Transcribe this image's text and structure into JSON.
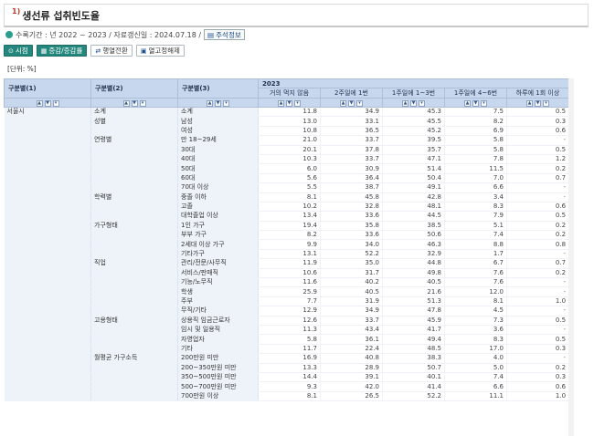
{
  "title": {
    "number": "1)",
    "text": "생선류 섭취빈도율"
  },
  "meta": {
    "text": "수록기간 : 년 2022 ~ 2023 / 자료갱신일 : 2024.07.18 /",
    "note_label": "주석정보"
  },
  "toolbar": {
    "buttons": [
      {
        "label": "시점",
        "icon": "⊙"
      },
      {
        "label": "증감/증감률",
        "icon": "▦"
      },
      {
        "label": "행열전환",
        "icon": "⇄"
      },
      {
        "label": "열고정해제",
        "icon": "▣"
      }
    ]
  },
  "unit": "[단위: %]",
  "table": {
    "group_headers": [
      "구분별(1)",
      "구분별(2)",
      "구분별(3)"
    ],
    "year": "2023",
    "columns": [
      "거의 먹지 않음",
      "2주일에 1번",
      "1주일에 1~3번",
      "1주일에 4~6번",
      "하루에 1회 이상"
    ],
    "rows": [
      {
        "c1": "서울시",
        "c2": "소계",
        "c3": "소계",
        "v": [
          "11.8",
          "34.9",
          "45.3",
          "7.5",
          "0.5"
        ]
      },
      {
        "c1": "",
        "c2": "성별",
        "c3": "남성",
        "v": [
          "13.0",
          "33.1",
          "45.5",
          "8.2",
          "0.3"
        ]
      },
      {
        "c1": "",
        "c2": "",
        "c3": "여성",
        "v": [
          "10.8",
          "36.5",
          "45.2",
          "6.9",
          "0.6"
        ]
      },
      {
        "c1": "",
        "c2": "연령별",
        "c3": "만 18~29세",
        "v": [
          "21.0",
          "33.7",
          "39.5",
          "5.8",
          "-"
        ]
      },
      {
        "c1": "",
        "c2": "",
        "c3": "30대",
        "v": [
          "20.1",
          "37.8",
          "35.7",
          "5.8",
          "0.5"
        ]
      },
      {
        "c1": "",
        "c2": "",
        "c3": "40대",
        "v": [
          "10.3",
          "33.7",
          "47.1",
          "7.8",
          "1.2"
        ]
      },
      {
        "c1": "",
        "c2": "",
        "c3": "50대",
        "v": [
          "6.0",
          "30.9",
          "51.4",
          "11.5",
          "0.2"
        ]
      },
      {
        "c1": "",
        "c2": "",
        "c3": "60대",
        "v": [
          "5.6",
          "36.4",
          "50.4",
          "7.0",
          "0.7"
        ]
      },
      {
        "c1": "",
        "c2": "",
        "c3": "70대 이상",
        "v": [
          "5.5",
          "38.7",
          "49.1",
          "6.6",
          "-"
        ]
      },
      {
        "c1": "",
        "c2": "학력별",
        "c3": "중졸 이하",
        "v": [
          "8.1",
          "45.8",
          "42.8",
          "3.4",
          "-"
        ]
      },
      {
        "c1": "",
        "c2": "",
        "c3": "고졸",
        "v": [
          "10.2",
          "32.8",
          "48.1",
          "8.3",
          "0.6"
        ]
      },
      {
        "c1": "",
        "c2": "",
        "c3": "대학졸업 이상",
        "v": [
          "13.4",
          "33.6",
          "44.5",
          "7.9",
          "0.5"
        ]
      },
      {
        "c1": "",
        "c2": "가구형태",
        "c3": "1인 가구",
        "v": [
          "19.4",
          "35.8",
          "38.5",
          "5.1",
          "0.2"
        ]
      },
      {
        "c1": "",
        "c2": "",
        "c3": "부부 가구",
        "v": [
          "8.2",
          "33.6",
          "50.6",
          "7.4",
          "0.2"
        ]
      },
      {
        "c1": "",
        "c2": "",
        "c3": "2세대 이상 가구",
        "v": [
          "9.9",
          "34.0",
          "46.3",
          "8.8",
          "0.8"
        ]
      },
      {
        "c1": "",
        "c2": "",
        "c3": "기타가구",
        "v": [
          "13.1",
          "52.2",
          "32.9",
          "1.7",
          "-"
        ]
      },
      {
        "c1": "",
        "c2": "직업",
        "c3": "관리/전문/사무직",
        "v": [
          "11.9",
          "35.0",
          "44.8",
          "6.7",
          "0.7"
        ]
      },
      {
        "c1": "",
        "c2": "",
        "c3": "서비스/판매직",
        "v": [
          "10.6",
          "31.7",
          "49.8",
          "7.6",
          "0.2"
        ]
      },
      {
        "c1": "",
        "c2": "",
        "c3": "기능/노무직",
        "v": [
          "11.6",
          "40.2",
          "40.5",
          "7.6",
          "-"
        ]
      },
      {
        "c1": "",
        "c2": "",
        "c3": "학생",
        "v": [
          "25.9",
          "40.5",
          "21.6",
          "12.0",
          "-"
        ]
      },
      {
        "c1": "",
        "c2": "",
        "c3": "주부",
        "v": [
          "7.7",
          "31.9",
          "51.3",
          "8.1",
          "1.0"
        ]
      },
      {
        "c1": "",
        "c2": "",
        "c3": "무직/기타",
        "v": [
          "12.9",
          "34.9",
          "47.8",
          "4.5",
          "-"
        ]
      },
      {
        "c1": "",
        "c2": "고용형태",
        "c3": "상용직 임금근로자",
        "v": [
          "12.6",
          "33.7",
          "45.9",
          "7.3",
          "0.5"
        ]
      },
      {
        "c1": "",
        "c2": "",
        "c3": "임시 및 일용직",
        "v": [
          "11.3",
          "43.4",
          "41.7",
          "3.6",
          "-"
        ]
      },
      {
        "c1": "",
        "c2": "",
        "c3": "자영업자",
        "v": [
          "5.8",
          "36.1",
          "49.4",
          "8.3",
          "0.5"
        ]
      },
      {
        "c1": "",
        "c2": "",
        "c3": "기타",
        "v": [
          "11.7",
          "22.4",
          "48.5",
          "17.0",
          "0.3"
        ]
      },
      {
        "c1": "",
        "c2": "월평균 가구소득",
        "c3": "200만원 미만",
        "v": [
          "16.9",
          "40.8",
          "38.3",
          "4.0",
          "-"
        ]
      },
      {
        "c1": "",
        "c2": "",
        "c3": "200~350만원 미만",
        "v": [
          "13.3",
          "28.9",
          "50.7",
          "5.0",
          "0.2"
        ]
      },
      {
        "c1": "",
        "c2": "",
        "c3": "350~500만원 미만",
        "v": [
          "14.4",
          "39.1",
          "40.1",
          "7.4",
          "0.3"
        ]
      },
      {
        "c1": "",
        "c2": "",
        "c3": "500~700만원 미만",
        "v": [
          "9.3",
          "42.0",
          "41.4",
          "6.6",
          "0.6"
        ]
      },
      {
        "c1": "",
        "c2": "",
        "c3": "700만원 이상",
        "v": [
          "8.1",
          "26.5",
          "52.2",
          "11.1",
          "1.0"
        ]
      }
    ]
  }
}
